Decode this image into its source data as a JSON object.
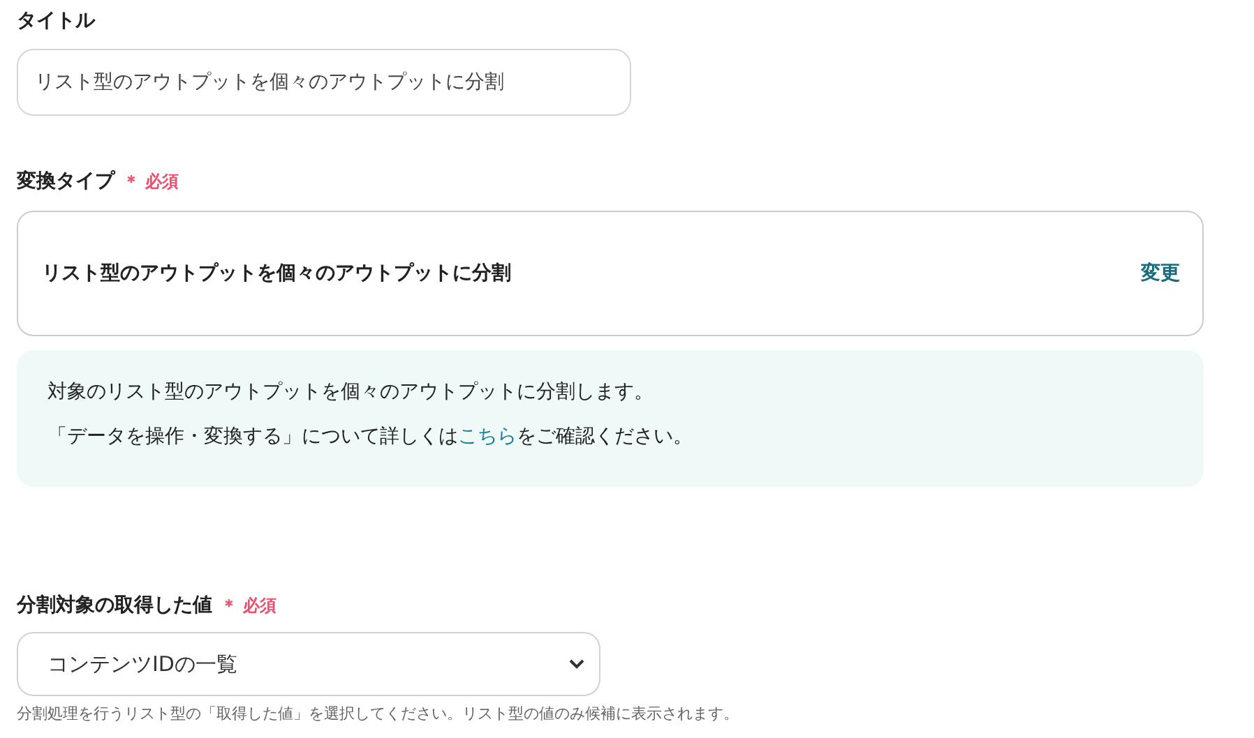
{
  "title_field": {
    "label": "タイトル",
    "value": "リスト型のアウトプットを個々のアウトプットに分割"
  },
  "conversion_type": {
    "label": "変換タイプ",
    "required_mark": "＊ 必須",
    "selected_type": "リスト型のアウトプットを個々のアウトプットに分割",
    "change_link": "変更"
  },
  "info": {
    "line_1": "対象のリスト型のアウトプットを個々のアウトプットに分割します。",
    "line_2_before": "「データを操作・変換する」について詳しくは",
    "line_2_link": "こちら",
    "line_2_after": "をご確認ください。"
  },
  "split_target": {
    "label": "分割対象の取得した値",
    "required_mark": "＊ 必須",
    "value": "コンテンツIDの一覧",
    "help": "分割処理を行うリスト型の「取得した値」を選択してください。リスト型の値のみ候補に表示されます。"
  }
}
